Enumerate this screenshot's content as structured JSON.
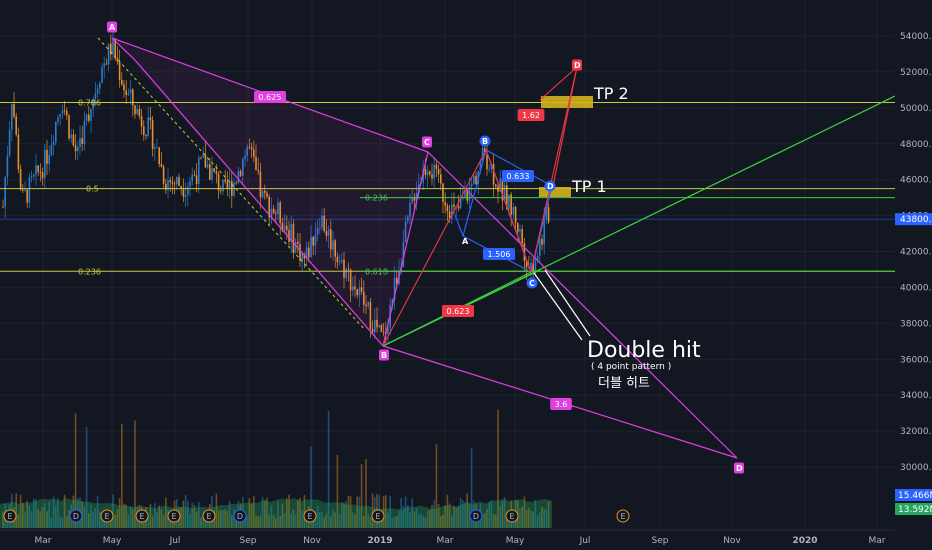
{
  "chart_data": {
    "type": "candlestick",
    "y_axis": {
      "ticks": [
        "54000.0",
        "52000.0",
        "50000.0",
        "48000.0",
        "46000.0",
        "44000.0",
        "42000.0",
        "40000.0",
        "38000.0",
        "36000.0",
        "34000.0",
        "32000.0",
        "30000.0"
      ],
      "ylim": [
        29000,
        55800
      ],
      "current_price": "43800.0",
      "volume_labels": [
        "15.466M",
        "13.592M"
      ]
    },
    "x_axis": {
      "ticks": [
        "Mar",
        "May",
        "Jul",
        "Sep",
        "Nov",
        "2019",
        "Mar",
        "May",
        "Jul",
        "Sep",
        "Nov",
        "2020",
        "Mar"
      ]
    },
    "fib_levels": [
      {
        "label": "0.786",
        "value": 50300,
        "color": "#c9c93a"
      },
      {
        "label": "0.5",
        "value": 45500,
        "color": "#c9c93a"
      },
      {
        "label": "0.236",
        "value": 40900,
        "color": "#c9c93a"
      }
    ],
    "green_levels": [
      {
        "label": "0.236",
        "value": 45000
      },
      {
        "label": "0.618",
        "value": 40900
      }
    ],
    "pattern_points": [
      {
        "label": "A",
        "price": 54000,
        "color": "#e040e0"
      },
      {
        "label": "B",
        "price": 36900,
        "color": "#e040e0"
      },
      {
        "label": "C",
        "price": 47500,
        "color": "#e040e0"
      },
      {
        "label": "D",
        "price": 30500,
        "color": "#e040e0"
      },
      {
        "label": "A",
        "price": 43000,
        "color": "#2962ff"
      },
      {
        "label": "B",
        "price": 47500,
        "color": "#2962ff"
      },
      {
        "label": "C",
        "price": 40900,
        "color": "#2962ff"
      },
      {
        "label": "D",
        "price": 45500,
        "color": "#2962ff"
      },
      {
        "label": "D",
        "price": 52000,
        "color": "#f23645"
      }
    ],
    "ratios": [
      {
        "label": "0.625",
        "color": "#e040e0"
      },
      {
        "label": "3.6",
        "color": "#e040e0"
      },
      {
        "label": "0.633",
        "color": "#2962ff"
      },
      {
        "label": "1.506",
        "color": "#2962ff"
      },
      {
        "label": "1.62",
        "color": "#f23645"
      },
      {
        "label": "0.623",
        "color": "#f23645"
      }
    ],
    "annotations": {
      "tp1": "TP 1",
      "tp2": "TP 2",
      "title": "Double hit",
      "subtitle": "( 4 point pattern )",
      "korean": "더블 히트"
    },
    "event_markers": [
      "E",
      "D",
      "E",
      "E",
      "E",
      "E",
      "D",
      "E",
      "E",
      "D",
      "E"
    ]
  }
}
